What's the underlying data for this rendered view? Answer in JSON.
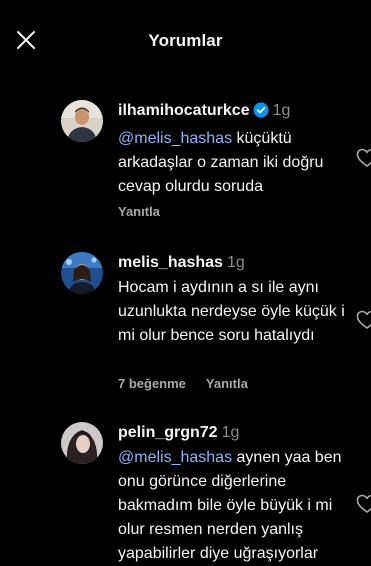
{
  "header": {
    "title": "Yorumlar"
  },
  "icons": {
    "close": "close-icon",
    "verified": "verified-badge-icon",
    "like": "heart-icon"
  },
  "colors": {
    "background": "#000000",
    "mention": "#8ab4ff",
    "verified": "#0095f6",
    "muted": "#a8a8a8"
  },
  "comments": [
    {
      "username": "ilhamihocaturkce",
      "verified": true,
      "time": "1g",
      "mention": "@melis_hashas",
      "text": " küçüktü arkadaşlar o zaman iki doğru cevap olurdu soruda",
      "likes": "",
      "reply": "Yanıtla"
    },
    {
      "username": "melis_hashas",
      "verified": false,
      "time": "1g",
      "mention": "",
      "text": "Hocam i aydının a sı ile aynı uzunlukta nerdeyse öyle küçük i mi olur bence soru hatalıydı",
      "likes": "7 beğenme",
      "reply": "Yanıtla"
    },
    {
      "username": "pelin_grgn72",
      "verified": false,
      "time": "1g",
      "mention": "@melis_hashas",
      "text": " aynen yaa ben onu görünce diğerlerine bakmadım bile öyle büyük i mi olur resmen nerden yanlış yapabilirler diye uğraşıyorlar",
      "likes": "",
      "reply": ""
    }
  ]
}
